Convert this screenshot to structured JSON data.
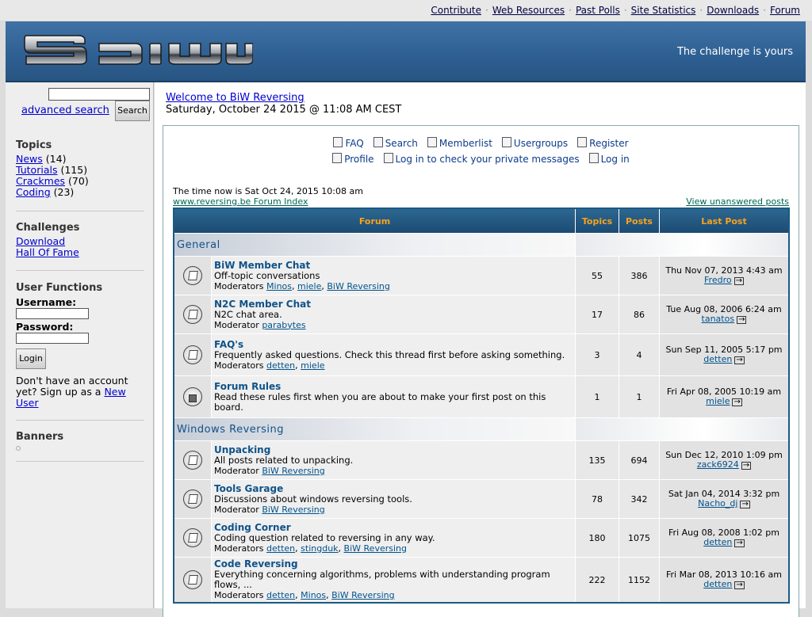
{
  "toplinks": [
    "Contribute",
    "Web Resources",
    "Past Polls",
    "Site Statistics",
    "Downloads",
    "Forum"
  ],
  "banner": {
    "tagline": "The challenge is yours"
  },
  "sidebar": {
    "advanced_search": "advanced search",
    "search_button": "Search",
    "topics_title": "Topics",
    "topics": [
      {
        "label": "News",
        "count": "(14)"
      },
      {
        "label": "Tutorials",
        "count": "(115)"
      },
      {
        "label": "Crackmes",
        "count": "(70)"
      },
      {
        "label": "Coding",
        "count": "(23)"
      }
    ],
    "challenges_title": "Challenges",
    "challenges": [
      "Download",
      "Hall Of Fame"
    ],
    "user_functions_title": "User Functions",
    "username_label": "Username:",
    "password_label": "Password:",
    "login_button": "Login",
    "signup_text": "Don't have an account yet? Sign up as a ",
    "signup_link": "New User",
    "banners_title": "Banners"
  },
  "main": {
    "welcome": "Welcome to BiW Reversing",
    "date": "Saturday, October 24 2015 @ 11:08 AM CEST",
    "nav_row1": [
      {
        "label": "FAQ",
        "icon": "faq-icon"
      },
      {
        "label": "Search",
        "icon": "search-icon"
      },
      {
        "label": "Memberlist",
        "icon": "memberlist-icon"
      },
      {
        "label": "Usergroups",
        "icon": "usergroups-icon"
      },
      {
        "label": "Register",
        "icon": "register-icon"
      }
    ],
    "nav_row2": [
      {
        "label": "Profile",
        "icon": "profile-icon"
      },
      {
        "label": "Log in to check your private messages",
        "icon": "messages-icon"
      },
      {
        "label": "Log in",
        "icon": "login-icon"
      }
    ],
    "time_now": "The time now is Sat Oct 24, 2015 10:08 am",
    "index_link": "www.reversing.be Forum Index",
    "unanswered": "View unanswered posts",
    "headers": {
      "forum": "Forum",
      "topics": "Topics",
      "posts": "Posts",
      "last_post": "Last Post"
    },
    "categories": [
      {
        "name": "General",
        "forums": [
          {
            "name": "BiW Member Chat",
            "desc": "Off-topic conversations",
            "mod_label": "Moderators",
            "mods": [
              "Minos",
              "miele",
              "BiW Reversing"
            ],
            "topics": "55",
            "posts": "386",
            "last_date": "Thu Nov 07, 2013 4:43 am",
            "last_user": "Fredro",
            "locked": false
          },
          {
            "name": "N2C Member Chat",
            "desc": "N2C chat area.",
            "mod_label": "Moderator",
            "mods": [
              "parabytes"
            ],
            "topics": "17",
            "posts": "86",
            "last_date": "Tue Aug 08, 2006 6:24 am",
            "last_user": "tanatos",
            "locked": false
          },
          {
            "name": "FAQ's",
            "desc": "Frequently asked questions. Check this thread first before asking something.",
            "mod_label": "Moderators",
            "mods": [
              "detten",
              "miele"
            ],
            "topics": "3",
            "posts": "4",
            "last_date": "Sun Sep 11, 2005 5:17 pm",
            "last_user": "detten",
            "locked": false
          },
          {
            "name": "Forum Rules",
            "desc": "Read these rules first when you are about to make your first post on this board.",
            "mod_label": "",
            "mods": [],
            "topics": "1",
            "posts": "1",
            "last_date": "Fri Apr 08, 2005 10:19 am",
            "last_user": "miele",
            "locked": true
          }
        ]
      },
      {
        "name": "Windows Reversing",
        "forums": [
          {
            "name": "Unpacking",
            "desc": "All posts related to unpacking.",
            "mod_label": "Moderator",
            "mods": [
              "BiW Reversing"
            ],
            "topics": "135",
            "posts": "694",
            "last_date": "Sun Dec 12, 2010 1:09 pm",
            "last_user": "zack6924",
            "locked": false
          },
          {
            "name": "Tools Garage",
            "desc": "Discussions about windows reversing tools.",
            "mod_label": "Moderator",
            "mods": [
              "BiW Reversing"
            ],
            "topics": "78",
            "posts": "342",
            "last_date": "Sat Jan 04, 2014 3:32 pm",
            "last_user": "Nacho_dj",
            "locked": false
          },
          {
            "name": "Coding Corner",
            "desc": "Coding question related to reversing in any way.",
            "mod_label": "Moderators",
            "mods": [
              "detten",
              "stingduk",
              "BiW Reversing"
            ],
            "topics": "180",
            "posts": "1075",
            "last_date": "Fri Aug 08, 2008 1:02 pm",
            "last_user": "detten",
            "locked": false
          },
          {
            "name": "Code Reversing",
            "desc": "Everything concerning algorithms, problems with understanding program flows, ...",
            "mod_label": "Moderators",
            "mods": [
              "detten",
              "Minos",
              "BiW Reversing"
            ],
            "topics": "222",
            "posts": "1152",
            "last_date": "Fri Mar 08, 2013 10:16 am",
            "last_user": "detten",
            "locked": false
          }
        ]
      }
    ]
  }
}
